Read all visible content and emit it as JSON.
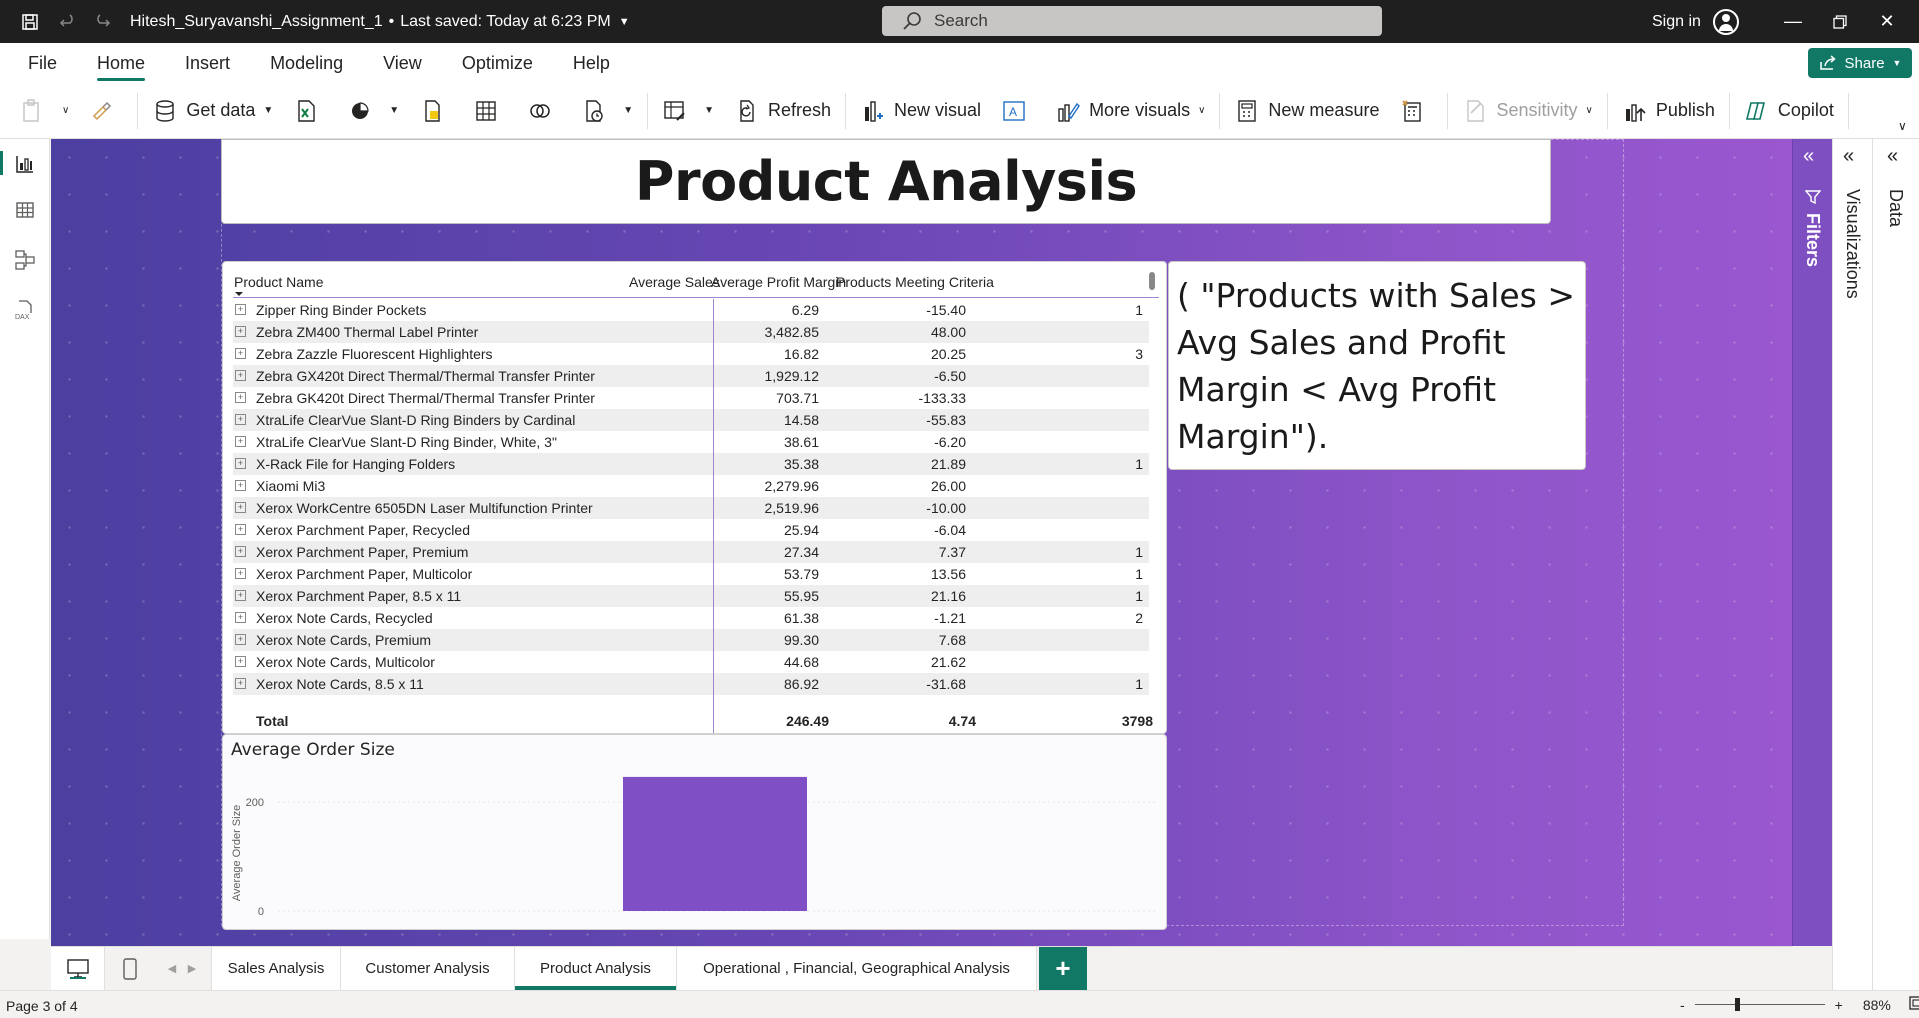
{
  "titlebar": {
    "file_name": "Hitesh_Suryavanshi_Assignment_1",
    "separator": "•",
    "saved_status": "Last saved: Today at 6:23 PM",
    "search_placeholder": "Search",
    "signin_label": "Sign in"
  },
  "menu": {
    "items": [
      "File",
      "Home",
      "Insert",
      "Modeling",
      "View",
      "Optimize",
      "Help"
    ],
    "active": "Home",
    "share_label": "Share"
  },
  "ribbon": {
    "get_data": "Get data",
    "refresh": "Refresh",
    "new_visual": "New visual",
    "more_visuals": "More visuals",
    "new_measure": "New measure",
    "sensitivity": "Sensitivity",
    "publish": "Publish",
    "copilot": "Copilot"
  },
  "report": {
    "title": "Product Analysis",
    "table": {
      "columns": [
        "Product Name",
        "Average Sales",
        "Average Profit Margin",
        "Products Meeting Criteria"
      ],
      "rows": [
        {
          "name": "Zipper Ring Binder Pockets",
          "avg_sales": "6.29",
          "avg_margin": "-15.40",
          "meeting": "1"
        },
        {
          "name": "Zebra ZM400 Thermal Label Printer",
          "avg_sales": "3,482.85",
          "avg_margin": "48.00",
          "meeting": ""
        },
        {
          "name": "Zebra Zazzle Fluorescent Highlighters",
          "avg_sales": "16.82",
          "avg_margin": "20.25",
          "meeting": "3"
        },
        {
          "name": "Zebra GX420t Direct Thermal/Thermal Transfer Printer",
          "avg_sales": "1,929.12",
          "avg_margin": "-6.50",
          "meeting": ""
        },
        {
          "name": "Zebra GK420t Direct Thermal/Thermal Transfer Printer",
          "avg_sales": "703.71",
          "avg_margin": "-133.33",
          "meeting": ""
        },
        {
          "name": "XtraLife ClearVue Slant-D Ring Binders by Cardinal",
          "avg_sales": "14.58",
          "avg_margin": "-55.83",
          "meeting": ""
        },
        {
          "name": "XtraLife ClearVue Slant-D Ring Binder, White, 3\"",
          "avg_sales": "38.61",
          "avg_margin": "-6.20",
          "meeting": ""
        },
        {
          "name": "X-Rack File for Hanging Folders",
          "avg_sales": "35.38",
          "avg_margin": "21.89",
          "meeting": "1"
        },
        {
          "name": "Xiaomi Mi3",
          "avg_sales": "2,279.96",
          "avg_margin": "26.00",
          "meeting": ""
        },
        {
          "name": "Xerox WorkCentre 6505DN Laser Multifunction Printer",
          "avg_sales": "2,519.96",
          "avg_margin": "-10.00",
          "meeting": ""
        },
        {
          "name": "Xerox Parchment Paper, Recycled",
          "avg_sales": "25.94",
          "avg_margin": "-6.04",
          "meeting": ""
        },
        {
          "name": "Xerox Parchment Paper, Premium",
          "avg_sales": "27.34",
          "avg_margin": "7.37",
          "meeting": "1"
        },
        {
          "name": "Xerox Parchment Paper, Multicolor",
          "avg_sales": "53.79",
          "avg_margin": "13.56",
          "meeting": "1"
        },
        {
          "name": "Xerox Parchment Paper, 8.5 x 11",
          "avg_sales": "55.95",
          "avg_margin": "21.16",
          "meeting": "1"
        },
        {
          "name": "Xerox Note Cards, Recycled",
          "avg_sales": "61.38",
          "avg_margin": "-1.21",
          "meeting": "2"
        },
        {
          "name": "Xerox Note Cards, Premium",
          "avg_sales": "99.30",
          "avg_margin": "7.68",
          "meeting": ""
        },
        {
          "name": "Xerox Note Cards, Multicolor",
          "avg_sales": "44.68",
          "avg_margin": "21.62",
          "meeting": ""
        },
        {
          "name": "Xerox Note Cards, 8.5 x 11",
          "avg_sales": "86.92",
          "avg_margin": "-31.68",
          "meeting": "1"
        }
      ],
      "total": {
        "label": "Total",
        "avg_sales": "246.49",
        "avg_margin": "4.74",
        "meeting": "3798"
      }
    },
    "textbox": "( \"Products with Sales > Avg Sales and Profit Margin < Avg Profit Margin\").",
    "bar_chart": {
      "title": "Average Order Size"
    }
  },
  "chart_data": {
    "type": "bar",
    "title": "Average Order Size",
    "ylabel": "Average Order Size",
    "xlabel": "",
    "categories": [
      ""
    ],
    "values": [
      246.49
    ],
    "ylim": [
      0,
      250
    ],
    "yticks": [
      0,
      200
    ],
    "bar_color": "#7f4fc5"
  },
  "panes": {
    "filters": "Filters",
    "visualizations": "Visualizations",
    "data": "Data"
  },
  "page_tabs": {
    "tabs": [
      "Sales Analysis",
      "Customer Analysis",
      "Product Analysis",
      "Operational , Financial, Geographical Analysis"
    ],
    "active": "Product Analysis",
    "add": "+"
  },
  "status": {
    "page_indicator": "Page 3 of 4",
    "zoom_minus": "-",
    "zoom_plus": "+",
    "zoom": "88%"
  },
  "colors": {
    "accent": "#117865",
    "canvas_start": "#4b3fa0",
    "canvas_end": "#9a57cf",
    "bar": "#7f4fc5"
  }
}
